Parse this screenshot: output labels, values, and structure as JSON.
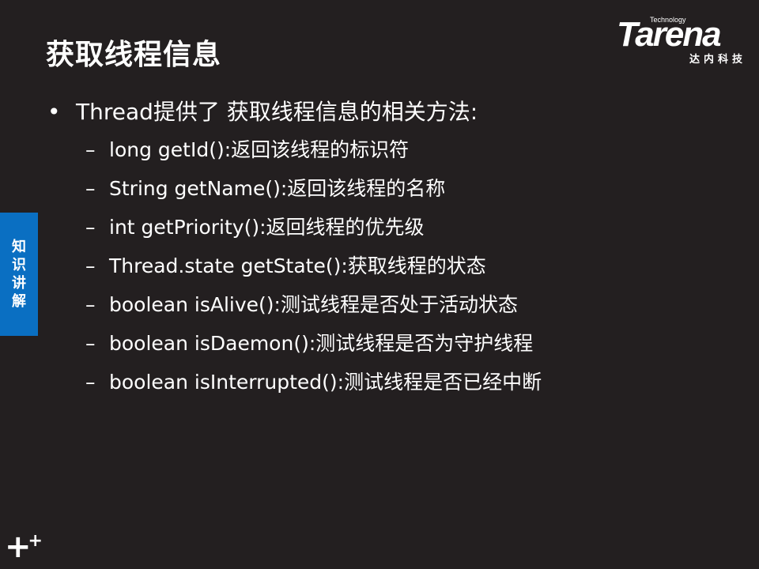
{
  "title": "获取线程信息",
  "logo": {
    "technology": "Technology",
    "brand": "Tarena",
    "chinese": "达内科技"
  },
  "bullet": {
    "text": "Thread提供了 获取线程信息的相关方法:"
  },
  "items": [
    "long getId():返回该线程的标识符",
    "String getName():返回该线程的名称",
    "int getPriority():返回线程的优先级",
    "Thread.state getState():获取线程的状态",
    "boolean isAlive():测试线程是否处于活动状态",
    "boolean isDaemon():测试线程是否为守护线程",
    "boolean isInterrupted():测试线程是否已经中断"
  ],
  "side_tab": [
    "知",
    "识",
    "讲",
    "解"
  ],
  "colors": {
    "background": "#231f20",
    "side_tab": "#0a6fc2"
  }
}
